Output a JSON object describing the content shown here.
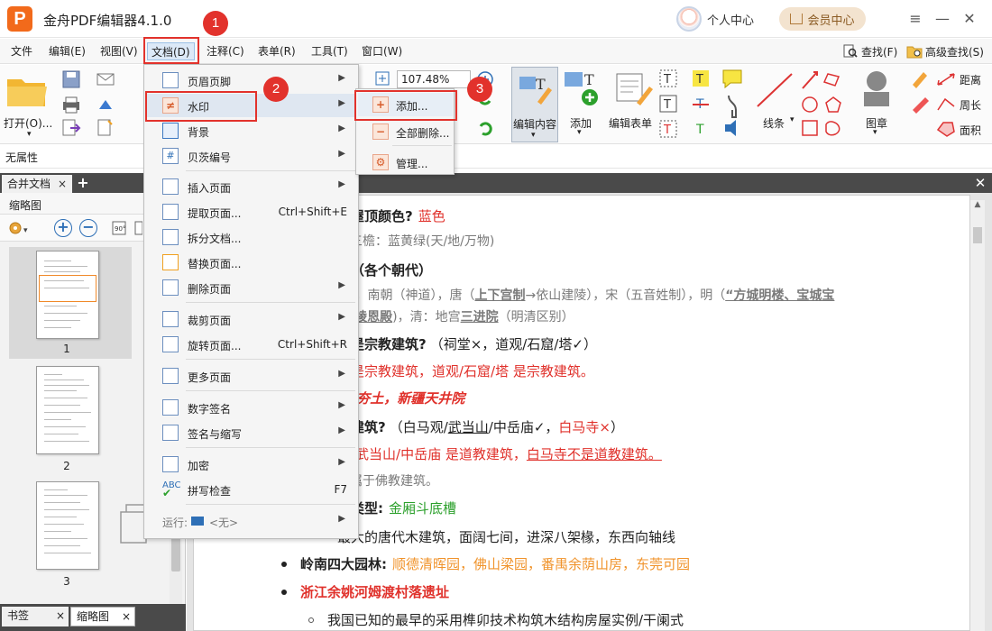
{
  "app": {
    "title": "金舟PDF编辑器4.1.0",
    "logo_letter": "P",
    "user_center": "个人中心",
    "vip_center": "会员中心",
    "window_controls": [
      "≡",
      "—",
      "☐",
      "✕"
    ]
  },
  "menubar": {
    "items": [
      "文件",
      "编辑(E)",
      "视图(V)",
      "文档(D)",
      "注释(C)",
      "表单(R)",
      "工具(T)",
      "窗口(W)"
    ],
    "active": "文档(D)",
    "find": "查找(F)",
    "advanced_find": "高级查找(S)"
  },
  "ribbon": {
    "open": "打开(O)...",
    "zoom": "107.48%",
    "edit_content": "编辑内容",
    "add": "添加",
    "edit_form": "编辑表单",
    "line": "线条",
    "stamp": "图章",
    "distance": "距离",
    "perimeter": "周长",
    "area": "面积"
  },
  "properties": {
    "label": "无属性"
  },
  "tabs": {
    "doc_tab": "合并文档",
    "close": "×"
  },
  "left_panel": {
    "title": "缩略图",
    "pages": [
      "1",
      "2",
      "3"
    ],
    "bottom_tabs": [
      "书签",
      "缩略图"
    ]
  },
  "dropdown": {
    "items": [
      {
        "label": "页眉页脚",
        "shortcut": "",
        "submenu": true
      },
      {
        "label": "水印",
        "shortcut": "",
        "submenu": true
      },
      {
        "label": "背景",
        "shortcut": "",
        "submenu": true
      },
      {
        "label": "贝茨编号",
        "shortcut": "",
        "submenu": true
      },
      {
        "label": "插入页面",
        "shortcut": "",
        "submenu": true
      },
      {
        "label": "提取页面...",
        "shortcut": "Ctrl+Shift+E",
        "submenu": false
      },
      {
        "label": "拆分文档...",
        "shortcut": "",
        "submenu": false
      },
      {
        "label": "替换页面...",
        "shortcut": "",
        "submenu": false
      },
      {
        "label": "删除页面",
        "shortcut": "",
        "submenu": true
      },
      {
        "label": "裁剪页面",
        "shortcut": "",
        "submenu": true
      },
      {
        "label": "旋转页面...",
        "shortcut": "Ctrl+Shift+R",
        "submenu": false
      },
      {
        "label": "更多页面",
        "shortcut": "",
        "submenu": true
      },
      {
        "label": "数字签名",
        "shortcut": "",
        "submenu": true
      },
      {
        "label": "签名与缩写",
        "shortcut": "",
        "submenu": true
      },
      {
        "label": "加密",
        "shortcut": "",
        "submenu": true
      },
      {
        "label": "拼写检查",
        "shortcut": "F7",
        "submenu": false
      },
      {
        "label": "运行:",
        "shortcut": "",
        "submenu": true,
        "extra": "<无>"
      }
    ]
  },
  "watermark_submenu": {
    "items": [
      "添加...",
      "全部删除...",
      "管理..."
    ]
  },
  "badges": [
    "1",
    "2",
    "3"
  ],
  "document": {
    "l1_a": "殿屋顶颜色?",
    "l1_b": "蓝色",
    "l2": "殳三檐：蓝黄绿(天/地/万物)",
    "l3": "点（各个朝代）",
    "l4_a": "寝)，南朝（神道），唐（",
    "l4_b": "上下宫制",
    "l4_c": "→依山建陵），宋（五音姓制），明（",
    "l4_d": "“方城明楼、宝城宝",
    "l5_a": "门/祾恩殿",
    "l5_b": ")，清：地宫",
    "l5_c": "三进院",
    "l5_d": "（明清区别）",
    "l6_a": "不是宗教建筑?",
    "l6_b": "（祠堂×，道观/石窟/塔✓）",
    "l7": "不是宗教建筑，道观/石窟/塔 是宗教建筑。",
    "l8": "居-夯土，新疆天井院",
    "l9_a": "教建筑?",
    "l9_b": "（白马观/",
    "l9_c": "武当山",
    "l9_d": "/中岳庙✓，",
    "l9_e": "白马寺×",
    "l9_f": "）",
    "l10_a": "观/武当山/中岳庙 是道教建筑，",
    "l10_b": "白马寺不是道教建筑。",
    "l11": "寺属于佛教建筑。",
    "l12_a": "面类型:",
    "l12_b": "金厢斗底槽",
    "l13": "最大的唐代木建筑，面阔七间，进深八架椽，东西向轴线",
    "l14_a": "岭南四大园林:",
    "l14_b": "顺德清晖园，佛山梁园，番禺余荫山房，东莞可园",
    "l15": "浙江余姚河姆渡村落遗址",
    "l16": "我国已知的最早的采用榫卯技术构筑木结构房屋实例/干阑式"
  },
  "colors": {
    "accent_red": "#e2322c",
    "brand_orange": "#f26a1b",
    "link_blue": "#2e6fb6"
  }
}
